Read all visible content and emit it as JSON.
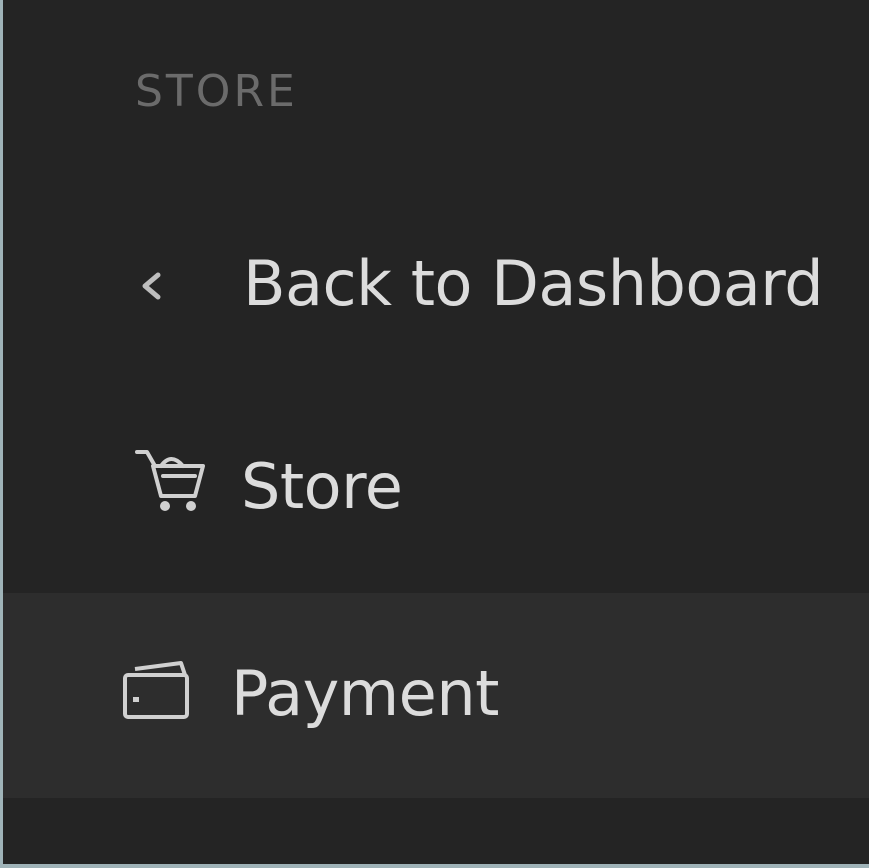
{
  "sidebar": {
    "section_label": "STORE",
    "items": [
      {
        "label": "Back to Dashboard",
        "icon": "chevron-left-icon"
      },
      {
        "label": "Store",
        "icon": "shopping-cart-icon"
      },
      {
        "label": "Payment",
        "icon": "wallet-icon",
        "active": true
      }
    ]
  },
  "colors": {
    "background": "#242424",
    "active_row": "#2d2d2d",
    "section_label": "#6b6b6b",
    "item_text": "#dcdcdc",
    "frame": "#9fb3b8"
  }
}
